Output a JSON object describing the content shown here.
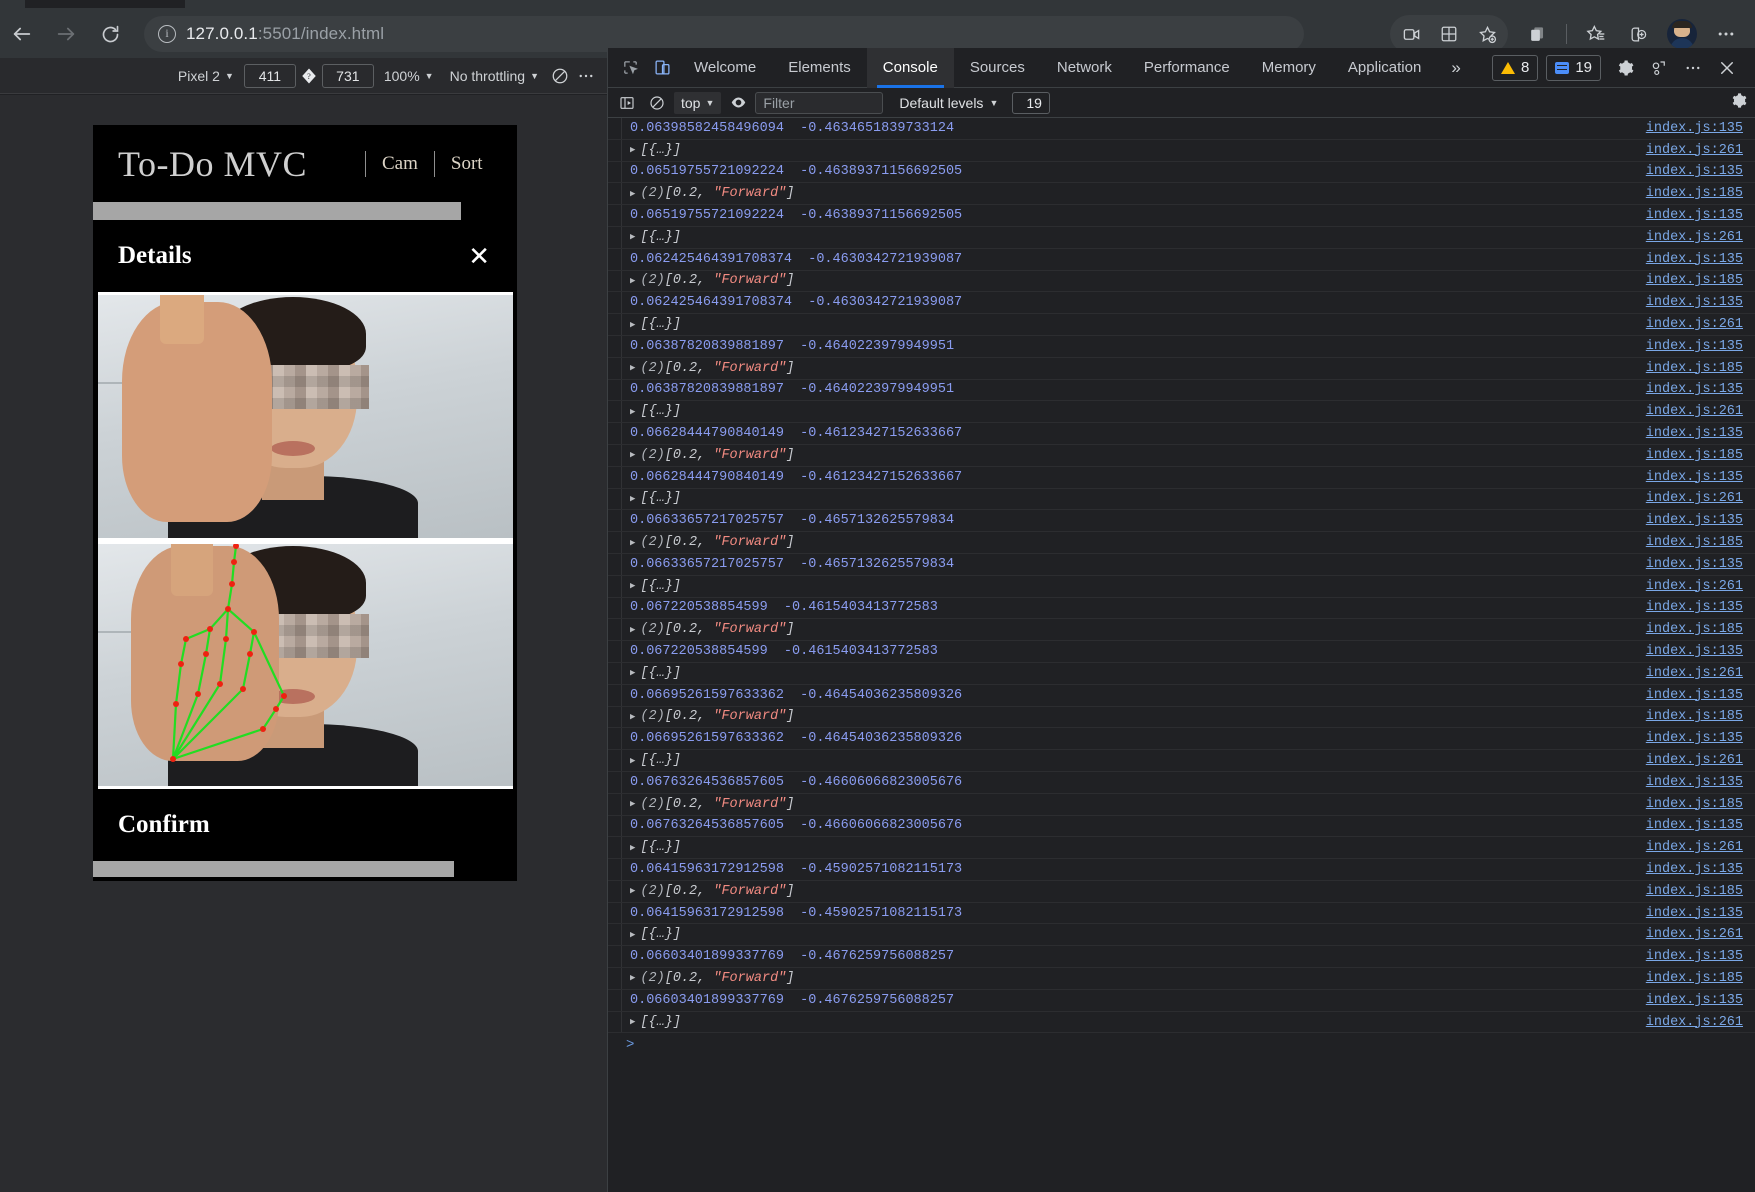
{
  "browser": {
    "url_host": "127.0.0.1",
    "url_rest": ":5501/index.html",
    "back_icon": "back-arrow-icon",
    "forward_icon": "forward-arrow-icon",
    "reload_icon": "reload-icon",
    "info_icon": "i",
    "right_icons": [
      "screen-record-icon",
      "split-screen-icon",
      "add-favorite-icon",
      "collections-icon",
      "favorites-icon",
      "add-tab-group-icon",
      "settings-more-icon"
    ]
  },
  "device_toolbar": {
    "device_label": "Pixel 2",
    "width": "411",
    "height": "731",
    "zoom": "100%",
    "throttling": "No throttling",
    "rotate_icon": "swap-dimensions-icon",
    "no_throttle_icon": "clear-icon",
    "more_icon": "more-options-icon"
  },
  "app": {
    "title": "To-Do MVC",
    "nav": [
      "Cam",
      "Sort"
    ],
    "detail_title": "Details",
    "close_label": "✕",
    "confirm_title": "Confirm"
  },
  "devtools": {
    "inspect_icon": "inspect-element-icon",
    "device_toggle_icon": "device-toolbar-icon",
    "tabs": [
      {
        "label": "Welcome",
        "selected": false
      },
      {
        "label": "Elements",
        "selected": false
      },
      {
        "label": "Console",
        "selected": true
      },
      {
        "label": "Sources",
        "selected": false
      },
      {
        "label": "Network",
        "selected": false
      },
      {
        "label": "Performance",
        "selected": false
      },
      {
        "label": "Memory",
        "selected": false
      },
      {
        "label": "Application",
        "selected": false
      }
    ],
    "more_tabs": "»",
    "warning_count": "8",
    "message_count": "19",
    "settings_icon": "gear-icon",
    "customize_icon": "dock-side-icon",
    "more_icon": "more-tools-icon",
    "close_icon": "close-icon",
    "filterbar": {
      "sidebar_icon": "console-sidebar-icon",
      "clear_icon": "clear-console-icon",
      "context": "top",
      "eye_icon": "live-expression-icon",
      "filter_placeholder": "Filter",
      "levels": "Default levels",
      "count": "19",
      "gear_icon": "console-settings-icon"
    },
    "prompt_symbol": ">"
  },
  "console_rows": [
    {
      "type": "num",
      "text": "0.06398582458496094  -0.4634651839733124",
      "src": "index.js:135"
    },
    {
      "type": "obj",
      "text": "[{…}]",
      "src": "index.js:261"
    },
    {
      "type": "num",
      "text": "0.06519755721092224  -0.46389371156692505",
      "src": "index.js:135"
    },
    {
      "type": "arr",
      "count": "(2)",
      "text": "[0.2, \"Forward\"]",
      "src": "index.js:185"
    },
    {
      "type": "num",
      "text": "0.06519755721092224  -0.46389371156692505",
      "src": "index.js:135"
    },
    {
      "type": "obj",
      "text": "[{…}]",
      "src": "index.js:261"
    },
    {
      "type": "num",
      "text": "0.062425464391708374  -0.4630342721939087",
      "src": "index.js:135"
    },
    {
      "type": "arr",
      "count": "(2)",
      "text": "[0.2, \"Forward\"]",
      "src": "index.js:185"
    },
    {
      "type": "num",
      "text": "0.062425464391708374  -0.4630342721939087",
      "src": "index.js:135"
    },
    {
      "type": "obj",
      "text": "[{…}]",
      "src": "index.js:261"
    },
    {
      "type": "num",
      "text": "0.06387820839881897  -0.4640223979949951",
      "src": "index.js:135"
    },
    {
      "type": "arr",
      "count": "(2)",
      "text": "[0.2, \"Forward\"]",
      "src": "index.js:185"
    },
    {
      "type": "num",
      "text": "0.06387820839881897  -0.4640223979949951",
      "src": "index.js:135"
    },
    {
      "type": "obj",
      "text": "[{…}]",
      "src": "index.js:261"
    },
    {
      "type": "num",
      "text": "0.06628444790840149  -0.46123427152633667",
      "src": "index.js:135"
    },
    {
      "type": "arr",
      "count": "(2)",
      "text": "[0.2, \"Forward\"]",
      "src": "index.js:185"
    },
    {
      "type": "num",
      "text": "0.06628444790840149  -0.46123427152633667",
      "src": "index.js:135"
    },
    {
      "type": "obj",
      "text": "[{…}]",
      "src": "index.js:261"
    },
    {
      "type": "num",
      "text": "0.06633657217025757  -0.4657132625579834",
      "src": "index.js:135"
    },
    {
      "type": "arr",
      "count": "(2)",
      "text": "[0.2, \"Forward\"]",
      "src": "index.js:185"
    },
    {
      "type": "num",
      "text": "0.06633657217025757  -0.4657132625579834",
      "src": "index.js:135"
    },
    {
      "type": "obj",
      "text": "[{…}]",
      "src": "index.js:261"
    },
    {
      "type": "num",
      "text": "0.067220538854599  -0.4615403413772583",
      "src": "index.js:135"
    },
    {
      "type": "arr",
      "count": "(2)",
      "text": "[0.2, \"Forward\"]",
      "src": "index.js:185"
    },
    {
      "type": "num",
      "text": "0.067220538854599  -0.4615403413772583",
      "src": "index.js:135"
    },
    {
      "type": "obj",
      "text": "[{…}]",
      "src": "index.js:261"
    },
    {
      "type": "num",
      "text": "0.06695261597633362  -0.46454036235809326",
      "src": "index.js:135"
    },
    {
      "type": "arr",
      "count": "(2)",
      "text": "[0.2, \"Forward\"]",
      "src": "index.js:185"
    },
    {
      "type": "num",
      "text": "0.06695261597633362  -0.46454036235809326",
      "src": "index.js:135"
    },
    {
      "type": "obj",
      "text": "[{…}]",
      "src": "index.js:261"
    },
    {
      "type": "num",
      "text": "0.06763264536857605  -0.46606066823005676",
      "src": "index.js:135"
    },
    {
      "type": "arr",
      "count": "(2)",
      "text": "[0.2, \"Forward\"]",
      "src": "index.js:185"
    },
    {
      "type": "num",
      "text": "0.06763264536857605  -0.46606066823005676",
      "src": "index.js:135"
    },
    {
      "type": "obj",
      "text": "[{…}]",
      "src": "index.js:261"
    },
    {
      "type": "num",
      "text": "0.06415963172912598  -0.45902571082115173",
      "src": "index.js:135"
    },
    {
      "type": "arr",
      "count": "(2)",
      "text": "[0.2, \"Forward\"]",
      "src": "index.js:185"
    },
    {
      "type": "num",
      "text": "0.06415963172912598  -0.45902571082115173",
      "src": "index.js:135"
    },
    {
      "type": "obj",
      "text": "[{…}]",
      "src": "index.js:261"
    },
    {
      "type": "num",
      "text": "0.06603401899337769  -0.4676259756088257",
      "src": "index.js:135"
    },
    {
      "type": "arr",
      "count": "(2)",
      "text": "[0.2, \"Forward\"]",
      "src": "index.js:185"
    },
    {
      "type": "num",
      "text": "0.06603401899337769  -0.4676259756088257",
      "src": "index.js:135"
    },
    {
      "type": "obj",
      "text": "[{…}]",
      "src": "index.js:261"
    }
  ],
  "colors": {
    "accent": "#1a73e8",
    "warning": "#fbbc04",
    "info": "#4b8df8",
    "number": "#8a9cf0",
    "string": "#f28b82",
    "link": "#7aa7e6"
  }
}
